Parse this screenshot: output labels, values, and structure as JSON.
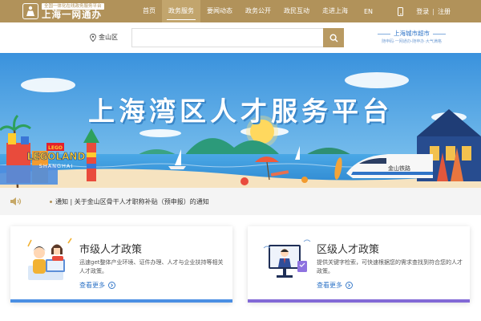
{
  "header": {
    "logo_tagline": "全国一体化在线政务服务平台",
    "logo_title": "上海一网通办",
    "logo_icon": "person-emblem-icon",
    "nav": [
      {
        "label": "首页",
        "active": false
      },
      {
        "label": "政务服务",
        "active": true
      },
      {
        "label": "要闻动态",
        "active": false
      },
      {
        "label": "政务公开",
        "active": false
      },
      {
        "label": "政民互动",
        "active": false
      },
      {
        "label": "走进上海",
        "active": false
      }
    ],
    "lang": "EN",
    "phone_icon": "mobile-phone-icon",
    "login": "登录",
    "divider": "|",
    "register": "注册"
  },
  "search": {
    "location": "金山区",
    "location_icon": "map-pin-icon",
    "placeholder": "",
    "button_icon": "search-icon"
  },
  "city_brand": {
    "title": "上海城市超市",
    "subtitle": "随申码·一网通办·随申办·大气满格"
  },
  "banner": {
    "title": "上海湾区人才服务平台",
    "legoland": "LEGOLAND",
    "legoland_sub": "SHANGHAI",
    "train_label": "金山铁路"
  },
  "notice": {
    "icon": "speaker-icon",
    "text": "通知 | 关于金山区骨干人才职称补贴（预申报）的通知"
  },
  "cards": [
    {
      "title": "市级人才政策",
      "desc": "迅速get整体产业环境、证件办理、人才与企业扶持等相关人才政策。",
      "more": "查看更多",
      "bar_color": "#4b8fe3"
    },
    {
      "title": "区级人才政策",
      "desc": "提供关键字检索，可快速根据您的需求查找到符合您的人才政策。",
      "more": "查看更多",
      "bar_color": "#8269d6"
    }
  ],
  "colors": {
    "brand_gold": "#b1925a",
    "link_blue": "#2f74c7",
    "banner_sky": "#3f9ae0"
  }
}
